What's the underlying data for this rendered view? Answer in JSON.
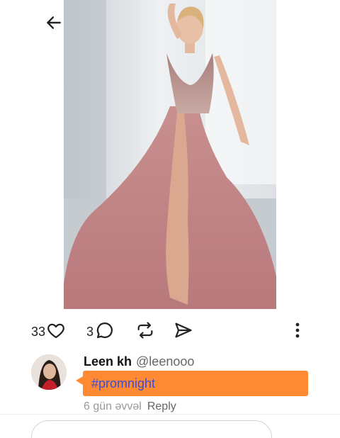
{
  "post": {
    "likes": "33",
    "comments": "3"
  },
  "comment": {
    "author_name": "Leen kh",
    "author_handle": "@leenooo",
    "text": "#promnight",
    "time": "6 gün əvvəl",
    "reply_label": "Reply"
  },
  "icons": {
    "back": "arrow-left-icon",
    "like": "heart-icon",
    "comment": "comment-bubble-icon",
    "repost": "repost-icon",
    "share": "send-icon",
    "more": "more-vertical-icon"
  },
  "colors": {
    "bubble": "#ff8a33",
    "hashtag": "#3c4dd8"
  }
}
